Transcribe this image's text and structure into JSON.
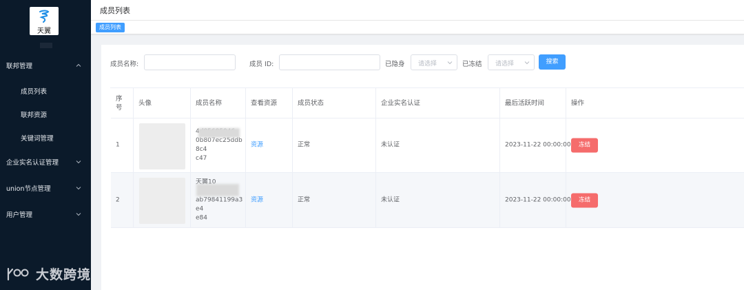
{
  "app": {
    "logo_text": "天翼"
  },
  "sidebar": {
    "menus": [
      {
        "label": "联邦管理",
        "expanded": true
      },
      {
        "label": "企业实名认证管理",
        "expanded": false
      },
      {
        "label": "union节点管理",
        "expanded": false
      },
      {
        "label": "用户管理",
        "expanded": false
      }
    ],
    "sub_items": [
      {
        "label": "成员列表"
      },
      {
        "label": "联邦资源"
      },
      {
        "label": "关键词管理"
      }
    ]
  },
  "watermark": {
    "text": "大数跨境"
  },
  "header": {
    "title": "成员列表",
    "tag": "成员列表"
  },
  "filters": {
    "name_label": "成员名称:",
    "name_value": "",
    "id_label": "成员 ID:",
    "id_value": "",
    "hidden_label": "已隐身",
    "hidden_placeholder": "请选择",
    "frozen_label": "已冻结",
    "frozen_placeholder": "请选择",
    "search_button": "搜索"
  },
  "table": {
    "columns": [
      "序号",
      "头像",
      "成员名称",
      "查看资源",
      "成员状态",
      "企业实名认证",
      "最后活跃时间",
      "操作"
    ],
    "rows": [
      {
        "index": "1",
        "name_line1": "4d85685946",
        "name_line2": "0b807ec25ddb8c4",
        "name_line3": "c47",
        "resource": "资源",
        "status": "正常",
        "cert": "未认证",
        "last_active": "2023-11-22 00:00:00",
        "action": "冻结"
      },
      {
        "index": "2",
        "name_line1": "天翼10",
        "name_line2": "",
        "name_line3": "ab79841199a3e4",
        "name_line4": "e84",
        "resource": "资源",
        "status": "正常",
        "cert": "未认证",
        "last_active": "2023-11-22 00:00:00",
        "action": "冻结"
      }
    ]
  },
  "colors": {
    "sidebar_bg": "#0b1a2a",
    "primary": "#409eff",
    "danger": "#f56c6c"
  }
}
